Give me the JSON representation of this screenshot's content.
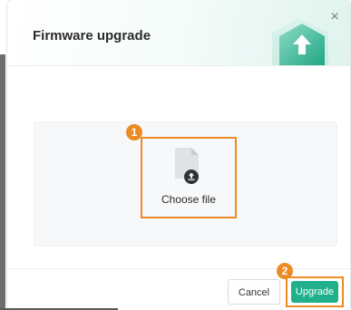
{
  "dialog": {
    "title": "Firmware upgrade",
    "close_glyph": "×",
    "header_icon": "upload-arrow-hexagon-icon"
  },
  "upload": {
    "choose_label": "Choose file",
    "file_icon": "file-upload-icon"
  },
  "footer": {
    "cancel_label": "Cancel",
    "upgrade_label": "Upgrade"
  },
  "annotations": {
    "step1": "1",
    "step2": "2"
  },
  "colors": {
    "accent": "#22b08c",
    "annotation": "#ec8b23",
    "header_tint": "#dff3ee"
  }
}
